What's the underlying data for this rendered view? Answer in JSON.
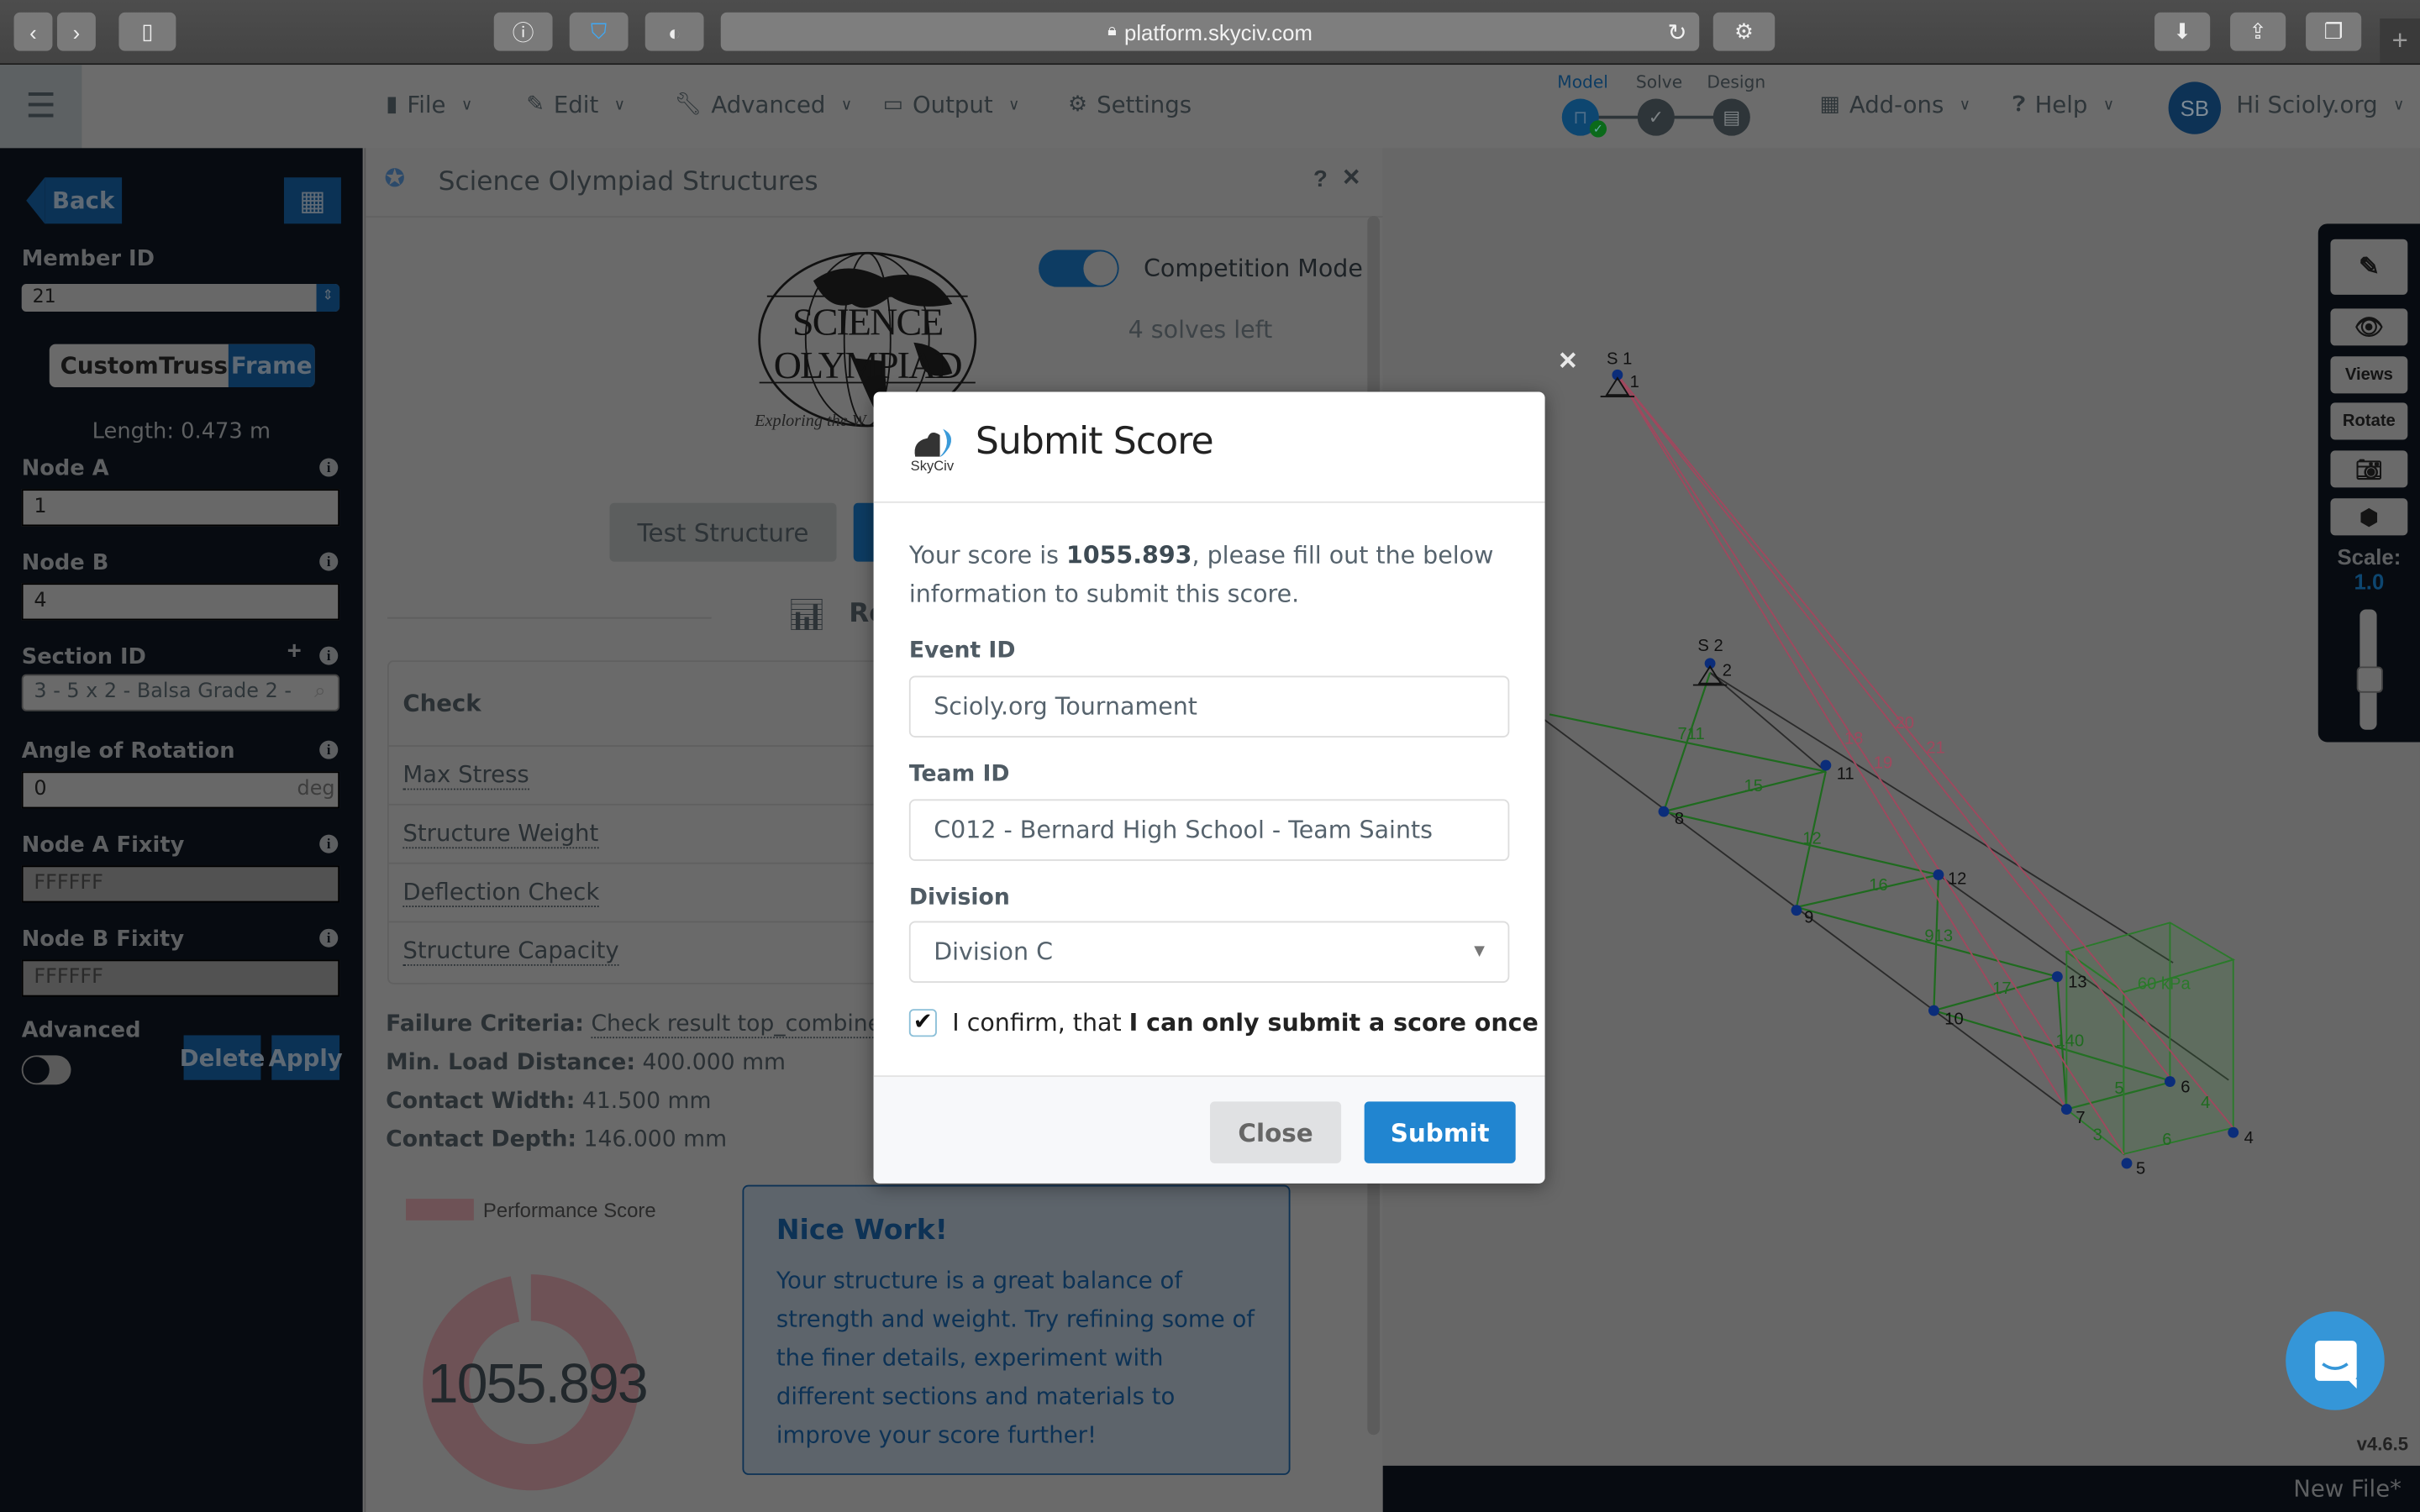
{
  "browser": {
    "url": "platform.skyciv.com",
    "icons": [
      "back-icon",
      "forward-icon",
      "sidebar-icon",
      "info-icon",
      "shield-icon",
      "privacy-icon",
      "reload-icon",
      "settings-icon",
      "download-icon",
      "share-icon",
      "tabs-icon",
      "new-tab-icon"
    ]
  },
  "topbar": {
    "menu": [
      {
        "icon": "file-icon",
        "label": "File"
      },
      {
        "icon": "pencil-icon",
        "label": "Edit"
      },
      {
        "icon": "wrench-icon",
        "label": "Advanced"
      },
      {
        "icon": "monitor-icon",
        "label": "Output"
      },
      {
        "icon": "gear-icon",
        "label": "Settings"
      }
    ],
    "steps": [
      {
        "label": "Model",
        "state": "complete",
        "active": true
      },
      {
        "label": "Solve",
        "state": "pending",
        "active": false
      },
      {
        "label": "Design",
        "state": "pending",
        "active": false
      }
    ],
    "addons": "Add-ons",
    "help": "Help",
    "avatar_initials": "SB",
    "user_greeting": "Hi Scioly.org"
  },
  "sidebar": {
    "back": "Back",
    "member_id_label": "Member ID",
    "member_id": "21",
    "types": [
      "Custom",
      "Truss",
      "Frame"
    ],
    "active_type": "Frame",
    "length": "Length: 0.473 m",
    "node_a_label": "Node A",
    "node_a": "1",
    "node_b_label": "Node B",
    "node_b": "4",
    "section_label": "Section ID",
    "section": "3 - 5 x 2 - Balsa Grade 2 -",
    "angle_label": "Angle of Rotation",
    "angle": "0",
    "angle_unit": "deg",
    "fixity_a_label": "Node A Fixity",
    "fixity_a": "FFFFFF",
    "fixity_b_label": "Node B Fixity",
    "fixity_b": "FFFFFF",
    "advanced_label": "Advanced",
    "advanced_on": false,
    "delete": "Delete",
    "apply": "Apply"
  },
  "panel": {
    "title": "Science Olympiad Structures",
    "help": "?",
    "close": "×",
    "logo_text": "SCIENCE OLYMPIAD",
    "logo_tagline": "Exploring the W",
    "competition_mode_label": "Competition Mode",
    "competition_mode_on": true,
    "solves_left": "4 solves left",
    "test_button": "Test Structure",
    "results_heading": "Re",
    "table_header": "Check",
    "checks": [
      "Max Stress",
      "Structure Weight",
      "Deflection Check",
      "Structure Capacity"
    ],
    "failure_label": "Failure Criteria:",
    "failure_value": "Check result top_combined_",
    "min_load_label": "Min. Load Distance:",
    "min_load_value": "400.000 mm",
    "contact_width_label": "Contact Width:",
    "contact_width_value": "41.500 mm",
    "contact_depth_label": "Contact Depth:",
    "contact_depth_value": "146.000 mm",
    "legend": "Performance Score",
    "score": "1055.893",
    "score_fill_fraction": 0.97,
    "nice_title": "Nice Work!",
    "nice_body": "Your structure is a great balance of strength and weight. Try refining some of the finer details, experiment with different sections and materials to improve your score further!"
  },
  "viewport": {
    "close": "×",
    "supports": [
      "S 1",
      "S 2"
    ],
    "node_labels": [
      "1",
      "2",
      "4",
      "5",
      "6",
      "7",
      "8",
      "9",
      "10",
      "11",
      "12",
      "13"
    ],
    "member_labels": [
      "711",
      "15",
      "12",
      "16",
      "913",
      "17",
      "140",
      "5",
      "4",
      "3",
      "6",
      "18",
      "19",
      "20",
      "21"
    ],
    "load_label": "60 kPa",
    "toolbar": {
      "views": "Views",
      "rotate": "Rotate",
      "scale_label": "Scale:",
      "scale_value": "1.0",
      "icons": [
        "pencil-icon",
        "eye-icon",
        "camera-icon",
        "cube-icon"
      ]
    },
    "version": "v4.6.5",
    "file_name": "New File*"
  },
  "modal": {
    "logo_text": "SkyCiv",
    "title": "Submit Score",
    "intro_prefix": "Your score is ",
    "intro_score": "1055.893",
    "intro_suffix": ", please fill out the below information to submit this score.",
    "event_label": "Event ID",
    "event_value": "Scioly.org Tournament",
    "team_label": "Team ID",
    "team_value": "C012 - Bernard High School - Team Saints",
    "division_label": "Division",
    "division_value": "Division C",
    "confirm_checked": true,
    "confirm_prefix": "I confirm, that ",
    "confirm_bold": "I can only submit a score once",
    "close": "Close",
    "submit": "Submit"
  }
}
